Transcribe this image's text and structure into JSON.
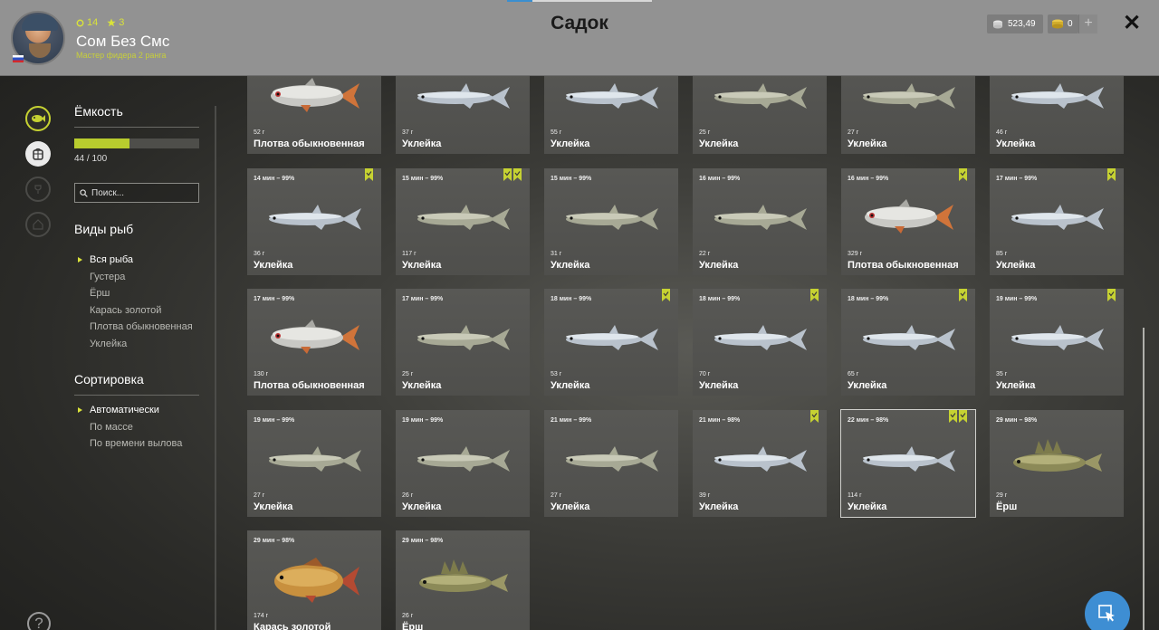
{
  "header": {
    "title": "Садок",
    "username": "Сом Без Смс",
    "rank": "Мастер фидера 2 ранга",
    "level": "14",
    "stars": "3",
    "money": "523,49",
    "gold": "0",
    "plus_label": "+",
    "close_label": "✕"
  },
  "capacity": {
    "title": "Ёмкость",
    "count_text": "44 / 100",
    "fill_fraction": 0.44
  },
  "search": {
    "placeholder": "Поиск..."
  },
  "species": {
    "title": "Виды рыб",
    "items": [
      "Вся рыба",
      "Густера",
      "Ёрш",
      "Карась золотой",
      "Плотва обыкновенная",
      "Уклейка"
    ],
    "selected": 0
  },
  "sort": {
    "title": "Сортировка",
    "items": [
      "Автоматически",
      "По массе",
      "По времени вылова"
    ],
    "selected": 0
  },
  "help_label": "?",
  "fish": [
    {
      "time": "",
      "weight": "52 г",
      "name": "Плотва обыкновенная",
      "kind": "roach",
      "badges": 0
    },
    {
      "time": "",
      "weight": "37 г",
      "name": "Уклейка",
      "kind": "bleak",
      "badges": 0
    },
    {
      "time": "",
      "weight": "55 г",
      "name": "Уклейка",
      "kind": "bleak",
      "badges": 0
    },
    {
      "time": "",
      "weight": "25 г",
      "name": "Уклейка",
      "kind": "bleak2",
      "badges": 0
    },
    {
      "time": "",
      "weight": "27 г",
      "name": "Уклейка",
      "kind": "bleak2",
      "badges": 0
    },
    {
      "time": "",
      "weight": "46 г",
      "name": "Уклейка",
      "kind": "bleak",
      "badges": 0
    },
    {
      "time": "14 мин – 99%",
      "weight": "36 г",
      "name": "Уклейка",
      "kind": "bleak",
      "badges": 1
    },
    {
      "time": "15 мин – 99%",
      "weight": "117 г",
      "name": "Уклейка",
      "kind": "bleak2",
      "badges": 2
    },
    {
      "time": "15 мин – 99%",
      "weight": "31 г",
      "name": "Уклейка",
      "kind": "bleak2",
      "badges": 0
    },
    {
      "time": "16 мин – 99%",
      "weight": "22 г",
      "name": "Уклейка",
      "kind": "bleak2",
      "badges": 0
    },
    {
      "time": "16 мин – 99%",
      "weight": "329 г",
      "name": "Плотва обыкновенная",
      "kind": "roach",
      "badges": 1
    },
    {
      "time": "17 мин – 99%",
      "weight": "85 г",
      "name": "Уклейка",
      "kind": "bleak",
      "badges": 1
    },
    {
      "time": "17 мин – 99%",
      "weight": "130 г",
      "name": "Плотва обыкновенная",
      "kind": "roach",
      "badges": 0
    },
    {
      "time": "17 мин – 99%",
      "weight": "25 г",
      "name": "Уклейка",
      "kind": "bleak2",
      "badges": 0
    },
    {
      "time": "18 мин – 99%",
      "weight": "53 г",
      "name": "Уклейка",
      "kind": "bleak",
      "badges": 1
    },
    {
      "time": "18 мин – 99%",
      "weight": "70 г",
      "name": "Уклейка",
      "kind": "bleak",
      "badges": 1
    },
    {
      "time": "18 мин – 99%",
      "weight": "65 г",
      "name": "Уклейка",
      "kind": "bleak",
      "badges": 1
    },
    {
      "time": "19 мин – 99%",
      "weight": "35 г",
      "name": "Уклейка",
      "kind": "bleak",
      "badges": 1
    },
    {
      "time": "19 мин – 99%",
      "weight": "27 г",
      "name": "Уклейка",
      "kind": "bleak2",
      "badges": 0
    },
    {
      "time": "19 мин – 99%",
      "weight": "26 г",
      "name": "Уклейка",
      "kind": "bleak2",
      "badges": 0
    },
    {
      "time": "21 мин – 99%",
      "weight": "27 г",
      "name": "Уклейка",
      "kind": "bleak2",
      "badges": 0
    },
    {
      "time": "21 мин – 98%",
      "weight": "39 г",
      "name": "Уклейка",
      "kind": "bleak",
      "badges": 1
    },
    {
      "time": "22 мин – 98%",
      "weight": "114 г",
      "name": "Уклейка",
      "kind": "bleak",
      "badges": 2,
      "selected": true
    },
    {
      "time": "29 мин – 98%",
      "weight": "29 г",
      "name": "Ёрш",
      "kind": "ruffe",
      "badges": 0
    },
    {
      "time": "29 мин – 98%",
      "weight": "174 г",
      "name": "Карась золотой",
      "kind": "carp",
      "badges": 0
    },
    {
      "time": "29 мин – 98%",
      "weight": "26 г",
      "name": "Ёрш",
      "kind": "ruffe",
      "badges": 0
    }
  ],
  "colors": {
    "accent": "#c6d232",
    "topbar": "#929292",
    "fab": "#3e8ed3"
  }
}
